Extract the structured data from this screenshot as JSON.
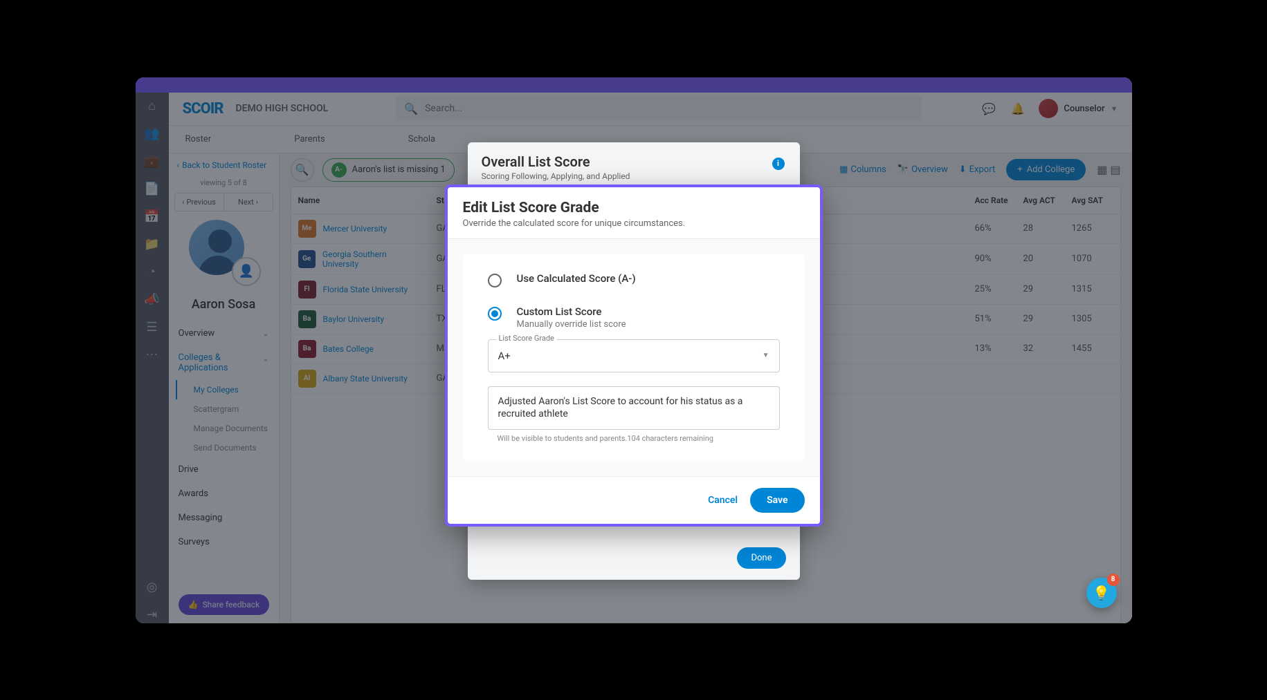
{
  "header": {
    "logo": "SCOIR",
    "school": "DEMO HIGH SCHOOL",
    "search_placeholder": "Search...",
    "user": "Counselor"
  },
  "tabs": {
    "roster": "Roster",
    "parents": "Parents",
    "schola": "Schola"
  },
  "sidebar": {
    "back": "Back to Student Roster",
    "viewing": "viewing 5 of 8",
    "prev": "Previous",
    "next": "Next",
    "student": "Aaron Sosa",
    "overview": "Overview",
    "colleges": "Colleges & Applications",
    "my_colleges": "My Colleges",
    "scattergram": "Scattergram",
    "manage_docs": "Manage Documents",
    "send_docs": "Send Documents",
    "drive": "Drive",
    "awards": "Awards",
    "messaging": "Messaging",
    "surveys": "Surveys",
    "feedback": "Share feedback"
  },
  "toolbar": {
    "score_grade": "A-",
    "score_text": "Aaron's list is missing 1",
    "columns": "Columns",
    "overview": "Overview",
    "export": "Export",
    "add_college": "Add College"
  },
  "table": {
    "headers": {
      "name": "Name",
      "state": "St",
      "acc_rate": "Acc Rate",
      "avg_act": "Avg ACT",
      "avg_sat": "Avg SAT"
    },
    "rows": [
      {
        "name": "Mercer University",
        "state": "GA",
        "acc": "66%",
        "act": "28",
        "sat": "1265",
        "color": "#d97526"
      },
      {
        "name": "Georgia Southern University",
        "state": "GA",
        "acc": "90%",
        "act": "20",
        "sat": "1070",
        "color": "#1f4e8c"
      },
      {
        "name": "Florida State University",
        "state": "FL",
        "acc": "25%",
        "act": "29",
        "sat": "1315",
        "color": "#7a1f2b"
      },
      {
        "name": "Baylor University",
        "state": "TX",
        "acc": "51%",
        "act": "29",
        "sat": "1305",
        "color": "#1a593a"
      },
      {
        "name": "Bates College",
        "state": "ME",
        "acc": "13%",
        "act": "32",
        "sat": "1455",
        "color": "#8a1d2e"
      },
      {
        "name": "Albany State University",
        "state": "GA",
        "acc": "",
        "act": "",
        "sat": "",
        "color": "#d6a416"
      }
    ]
  },
  "list_panel": {
    "title": "Overall List Score",
    "sub": "Scoring Following, Applying, and Applied",
    "done": "Done"
  },
  "modal": {
    "title": "Edit List Score Grade",
    "sub": "Override the calculated score for unique circumstances.",
    "opt1": "Use Calculated Score (A-)",
    "opt2_title": "Custom List Score",
    "opt2_sub": "Manually override list score",
    "select_legend": "List Score Grade",
    "select_value": "A+",
    "textarea_value": "Adjusted Aaron's List Score to account for his status as a recruited athlete",
    "textarea_hint": "Will be visible to students and parents.104 characters remaining",
    "cancel": "Cancel",
    "save": "Save"
  },
  "fab": {
    "badge": "8"
  }
}
